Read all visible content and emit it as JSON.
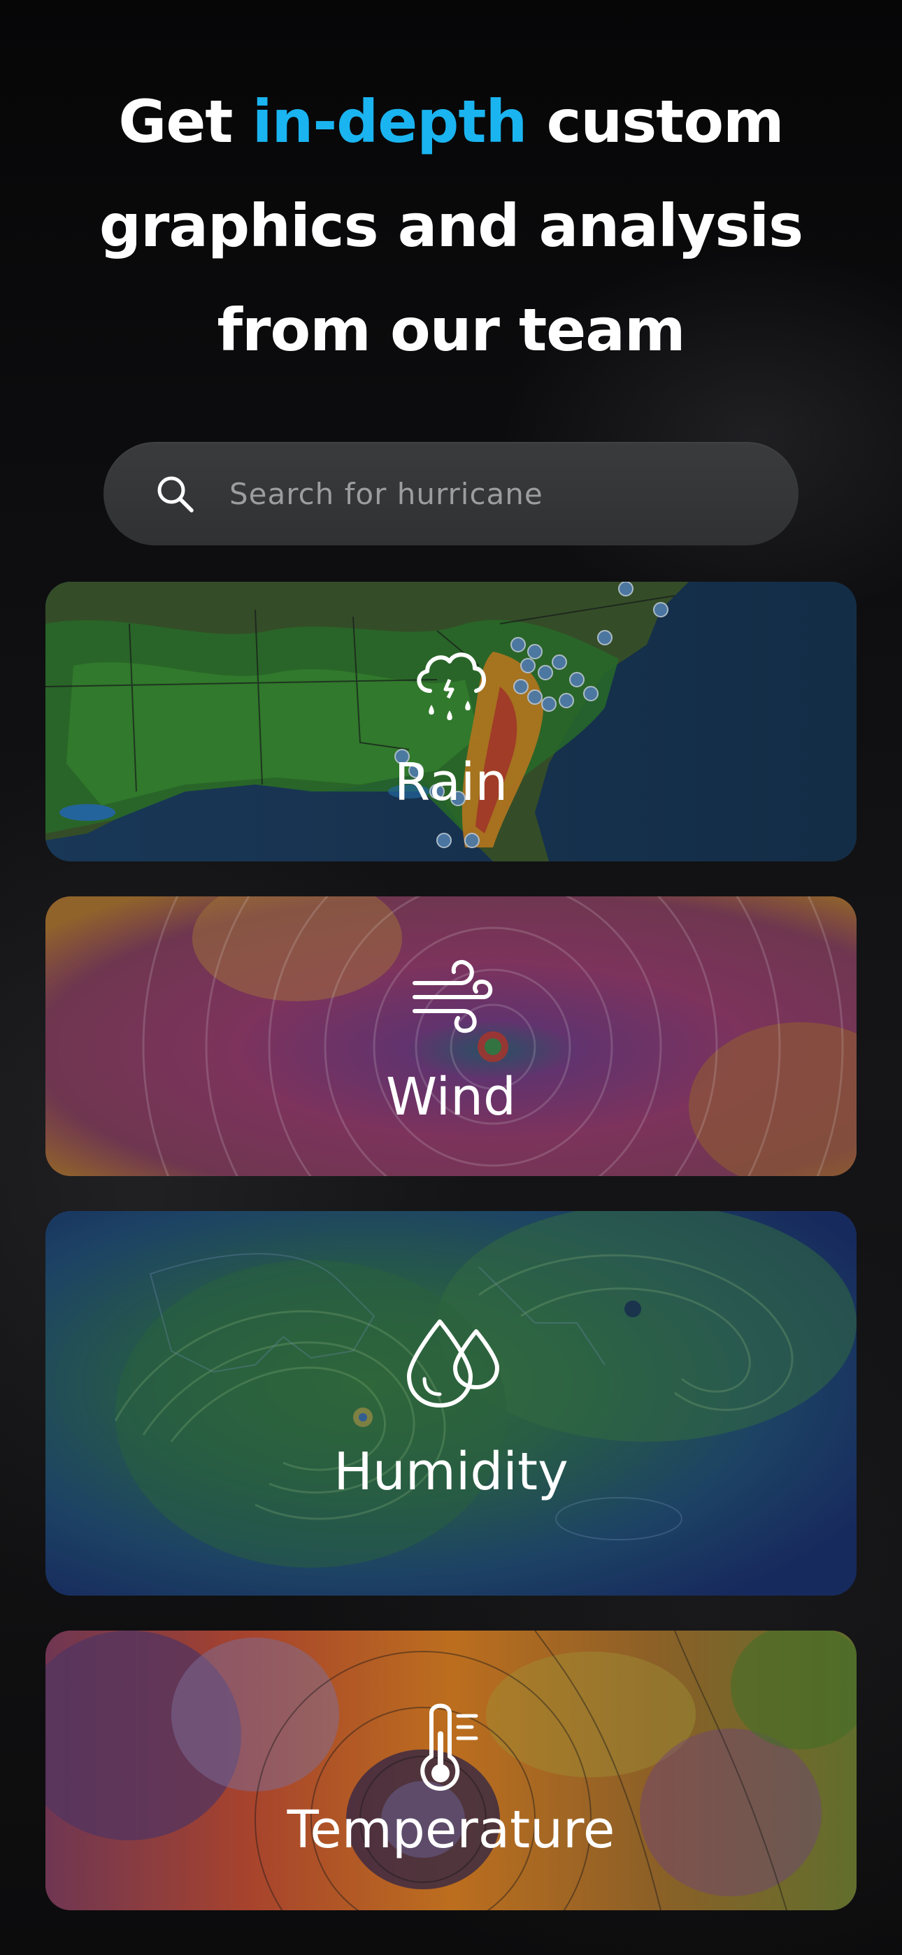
{
  "header": {
    "title_prefix": "Get ",
    "title_accent": "in-depth",
    "title_suffix_line1": " custom",
    "title_line2": "graphics and analysis",
    "title_line3": "from our team",
    "accent_color": "#1ab4f0"
  },
  "search": {
    "placeholder": "Search for hurricane",
    "value": "",
    "icon": "search-icon"
  },
  "categories": [
    {
      "label": "Rain",
      "icon": "rain-cloud-icon"
    },
    {
      "label": "Wind",
      "icon": "wind-icon"
    },
    {
      "label": "Humidity",
      "icon": "water-drops-icon"
    },
    {
      "label": "Temperature",
      "icon": "thermometer-icon"
    }
  ]
}
